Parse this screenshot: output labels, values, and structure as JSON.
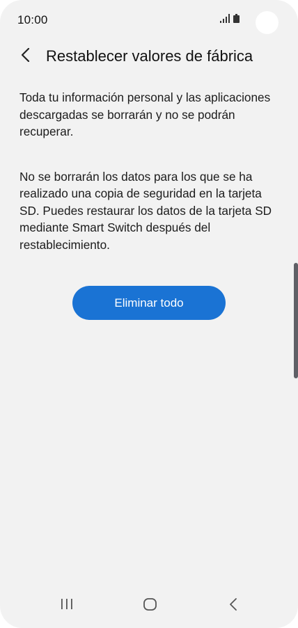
{
  "status_bar": {
    "time": "10:00",
    "icons": [
      "signal-icon",
      "battery-icon"
    ]
  },
  "header": {
    "back_icon": "chevron-left-icon",
    "title": "Restablecer valores de fábrica"
  },
  "content": {
    "paragraph_1": "Toda tu información personal y las aplicaciones descargadas se borrarán y no se podrán recuperar.",
    "paragraph_2": "No se borrarán los datos para los que se ha realizado una copia de seguridad en la tarjeta SD. Puedes restaurar los datos de la tarjeta SD mediante Smart Switch después del restablecimiento."
  },
  "action": {
    "label": "Eliminar todo",
    "color": "#1a73d4"
  },
  "nav_bar": {
    "icons": [
      "recent-apps-icon",
      "home-icon",
      "back-icon"
    ]
  }
}
